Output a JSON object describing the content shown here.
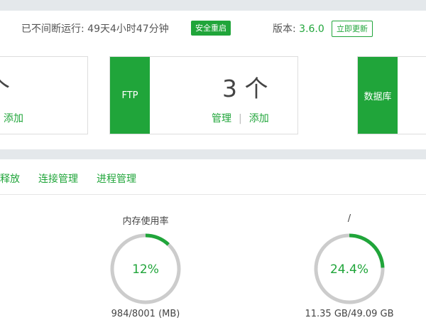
{
  "topbar": {
    "uptime": "已不间断运行: 49天4小时47分钟",
    "restart_label": "安全重启",
    "version_label": "版本:",
    "version_value": "3.6.0",
    "update_label": "立即更新"
  },
  "cards": [
    {
      "tag": "",
      "count": "个",
      "links": [
        "添加"
      ]
    },
    {
      "tag": "FTP",
      "count": "3 个",
      "links": [
        "管理",
        "添加"
      ]
    },
    {
      "tag": "数据库",
      "count": "",
      "links": []
    }
  ],
  "tabs": [
    "释放",
    "连接管理",
    "进程管理"
  ],
  "gauges": [
    {
      "title": "内存使用率",
      "value": "12%",
      "percent": 12,
      "detail": "984/8001 (MB)"
    },
    {
      "title": "/",
      "value": "24.4%",
      "percent": 24.4,
      "detail": "11.35 GB/49.09 GB"
    }
  ],
  "colors": {
    "accent": "#20a53a",
    "track": "#cccccc"
  }
}
